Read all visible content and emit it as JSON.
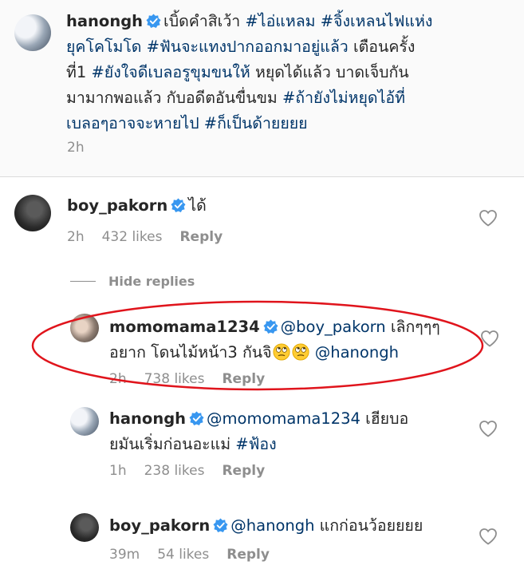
{
  "caption": {
    "username": "hanongh",
    "text_plain": "เบิ้ดคำสิเว้า ",
    "tags_line1": "#ไอ่แหลม #จิ้งเหลนไฟแห่ง",
    "tags_line2": "ยุคโคโมโด #ฟันจะแทงปากออกมาอยู่แล้ว",
    "text_line2b": " เตือนครั้ง",
    "text_line3a": "ที่1 ",
    "tags_line3": "#ยังใจดีเบลอรูขุมขนให้",
    "text_line3b": " หยุดได้แล้ว บาดเจ็บกัน",
    "text_line4a": "มามากพอแล้ว กับอดีตอันขื่นขม ",
    "tags_line4": "#ถ้ายังไม่หยุดไอ้ที่",
    "tags_line5": "เบลอๆอาจจะหายไป #ก็เป็นด้ายยยย",
    "time": "2h"
  },
  "comments": [
    {
      "username": "boy_pakorn",
      "line1": "ได้",
      "time": "2h",
      "likes": "432 likes",
      "reply": "Reply"
    },
    {
      "username": "momomama1234",
      "mention": "@boy_pakorn",
      "line1_rest": " เลิกๆๆๆ",
      "line2": "อยาก โดนไม้หน้า3 กันจิ",
      "mention2": "@hanongh",
      "time": "2h",
      "likes": "738 likes",
      "reply": "Reply"
    },
    {
      "username": "hanongh",
      "mention": "@momomama1234",
      "line1_rest": " เฮียบอ",
      "line2": "ยมันเริ่มก่อนอะแม่ ",
      "tag": "#ฟ้อง",
      "time": "1h",
      "likes": "238 likes",
      "reply": "Reply"
    },
    {
      "username": "boy_pakorn",
      "mention": "@hanongh",
      "line1_rest": " แกก่อนว้อยยยย",
      "time": "39m",
      "likes": "54 likes",
      "reply": "Reply"
    }
  ],
  "hide_replies": "Hide replies",
  "icons": {
    "verified": "verified-badge-icon",
    "heart": "heart-outline-icon",
    "emoji": "eye-roll-emoji-icon"
  },
  "colors": {
    "verified_blue": "#3897f0",
    "tag_blue": "#003569",
    "highlight_red": "#e0141c"
  }
}
